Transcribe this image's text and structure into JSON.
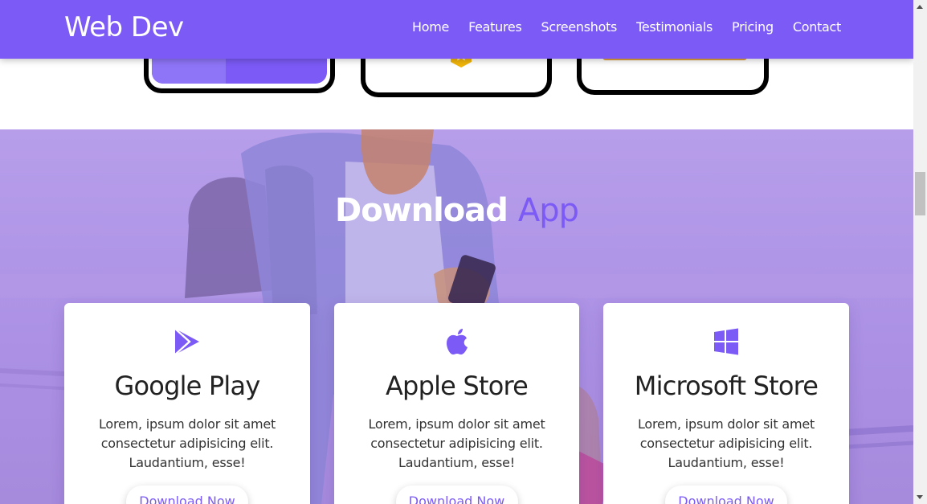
{
  "navbar": {
    "brand": "Web Dev",
    "links": [
      "Home",
      "Features",
      "Screenshots",
      "Testimonials",
      "Pricing",
      "Contact"
    ]
  },
  "download_section": {
    "title_main": "Download",
    "title_accent": "App",
    "cards": [
      {
        "icon": "google-play-icon",
        "title": "Google Play",
        "text": "Lorem, ipsum dolor sit amet consectetur adipisicing elit. Laudantium, esse!",
        "button": "Download Now"
      },
      {
        "icon": "apple-icon",
        "title": "Apple Store",
        "text": "Lorem, ipsum dolor sit amet consectetur adipisicing elit. Laudantium, esse!",
        "button": "Download Now"
      },
      {
        "icon": "windows-icon",
        "title": "Microsoft Store",
        "text": "Lorem, ipsum dolor sit amet consectetur adipisicing elit. Laudantium, esse!",
        "button": "Download Now"
      }
    ]
  },
  "colors": {
    "accent": "#7b5af6",
    "overlay": "#a98ee6",
    "badge": "#f1b50a"
  }
}
